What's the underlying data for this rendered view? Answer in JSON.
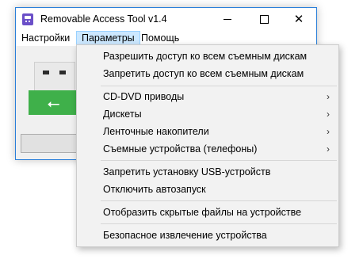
{
  "window": {
    "title": "Removable Access Tool v1.4"
  },
  "menubar": {
    "items": [
      {
        "label": "Настройки"
      },
      {
        "label": "Параметры"
      },
      {
        "label": "Помощь"
      }
    ]
  },
  "popup": {
    "items": [
      {
        "label": "Разрешить доступ ко всем съемным дискам"
      },
      {
        "label": "Запретить доступ ко всем съемным дискам"
      },
      {
        "label": "CD-DVD приводы",
        "submenu": "›"
      },
      {
        "label": "Дискеты",
        "submenu": "›"
      },
      {
        "label": "Ленточные накопители",
        "submenu": "›"
      },
      {
        "label": "Съемные устройства (телефоны)",
        "submenu": "›"
      },
      {
        "label": "Запретить установку USB-устройств"
      },
      {
        "label": "Отключить автозапуск"
      },
      {
        "label": "Отобразить скрытые файлы на устройстве"
      },
      {
        "label": "Безопасное извлечение устройства"
      }
    ]
  },
  "colors": {
    "accent_border": "#2a7fd9",
    "usb_green": "#3fb04a",
    "menu_highlight": "#cce8ff"
  },
  "icons": {
    "app": "usb-shield-icon",
    "usb_symbol": "usb-icon"
  }
}
